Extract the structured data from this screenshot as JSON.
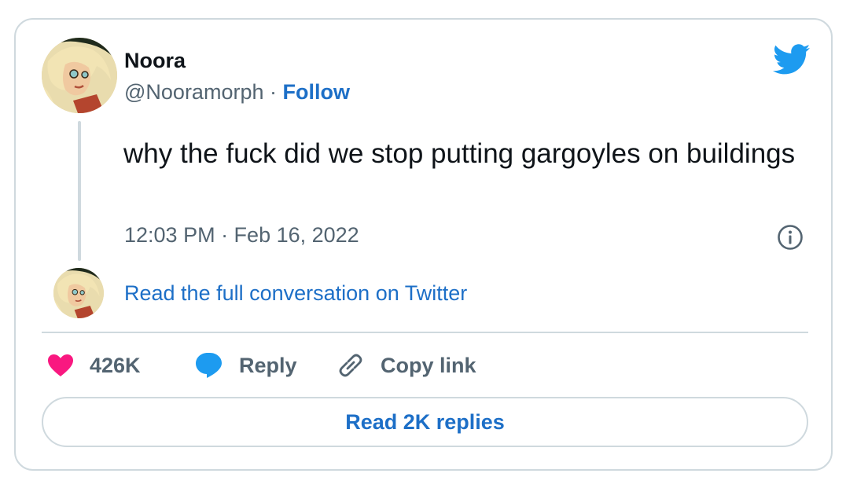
{
  "author": {
    "name": "Noora",
    "handle": "@Nooramorph",
    "separator": "·",
    "follow_label": "Follow"
  },
  "tweet": {
    "text": "why the fuck did we stop putting gargoyles on buildings",
    "timestamp": "12:03 PM · Feb 16, 2022"
  },
  "conversation_link": "Read the full conversation on Twitter",
  "actions": {
    "like_count": "426K",
    "reply_label": "Reply",
    "copy_link_label": "Copy link"
  },
  "read_replies_label": "Read 2K replies",
  "icons": {
    "brand": "twitter-bird-icon",
    "info": "info-icon",
    "like": "heart-icon",
    "reply": "speech-bubble-icon",
    "copy": "link-icon"
  },
  "colors": {
    "link_blue": "#1d6fc7",
    "twitter_blue": "#1d9bf0",
    "heart_pink": "#f91880",
    "text_primary": "#0f1419",
    "text_secondary": "#536471",
    "border": "#cfd9de"
  }
}
